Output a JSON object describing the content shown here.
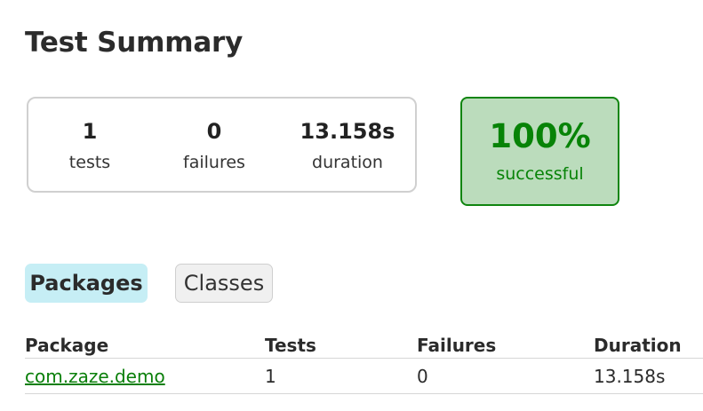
{
  "page": {
    "title": "Test Summary"
  },
  "summary": {
    "tests": {
      "value": "1",
      "label": "tests"
    },
    "failures": {
      "value": "0",
      "label": "failures"
    },
    "duration": {
      "value": "13.158s",
      "label": "duration"
    }
  },
  "success": {
    "percent": "100%",
    "label": "successful",
    "colors": {
      "background": "#bbdcbc",
      "border": "#0f850f",
      "text": "#078307"
    }
  },
  "tabs": [
    {
      "label": "Packages",
      "selected": true
    },
    {
      "label": "Classes",
      "selected": false
    }
  ],
  "table": {
    "headers": [
      "Package",
      "Tests",
      "Failures",
      "Duration"
    ],
    "rows": [
      {
        "package": "com.zaze.demo",
        "tests": "1",
        "failures": "0",
        "duration": "13.158s"
      }
    ]
  }
}
